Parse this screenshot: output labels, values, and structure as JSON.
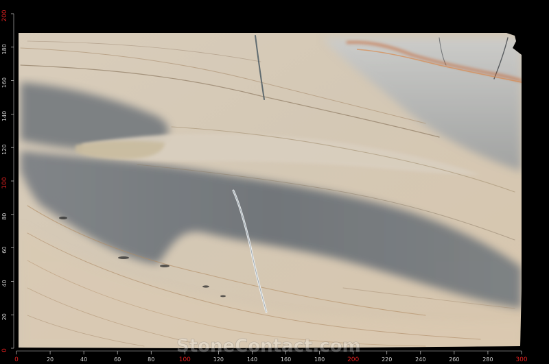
{
  "watermark": "StoneContact.com",
  "ruler": {
    "x_labels": [
      "0",
      "20",
      "40",
      "60",
      "80",
      "100",
      "120",
      "140",
      "160",
      "180",
      "200",
      "220",
      "240",
      "260",
      "280",
      "300"
    ],
    "y_labels": [
      "0",
      "20",
      "40",
      "60",
      "80",
      "100",
      "120",
      "140",
      "160",
      "180",
      "200"
    ],
    "major_labels": [
      "0",
      "100",
      "200",
      "300"
    ],
    "major_color": "#e02020",
    "minor_color": "#cfcfcf"
  },
  "colors": {
    "background": "#000000",
    "slab_base": "#d7cab7",
    "grey_band": "#6f757a",
    "vein_gold": "#b98a5a",
    "rust": "#c8602a"
  }
}
